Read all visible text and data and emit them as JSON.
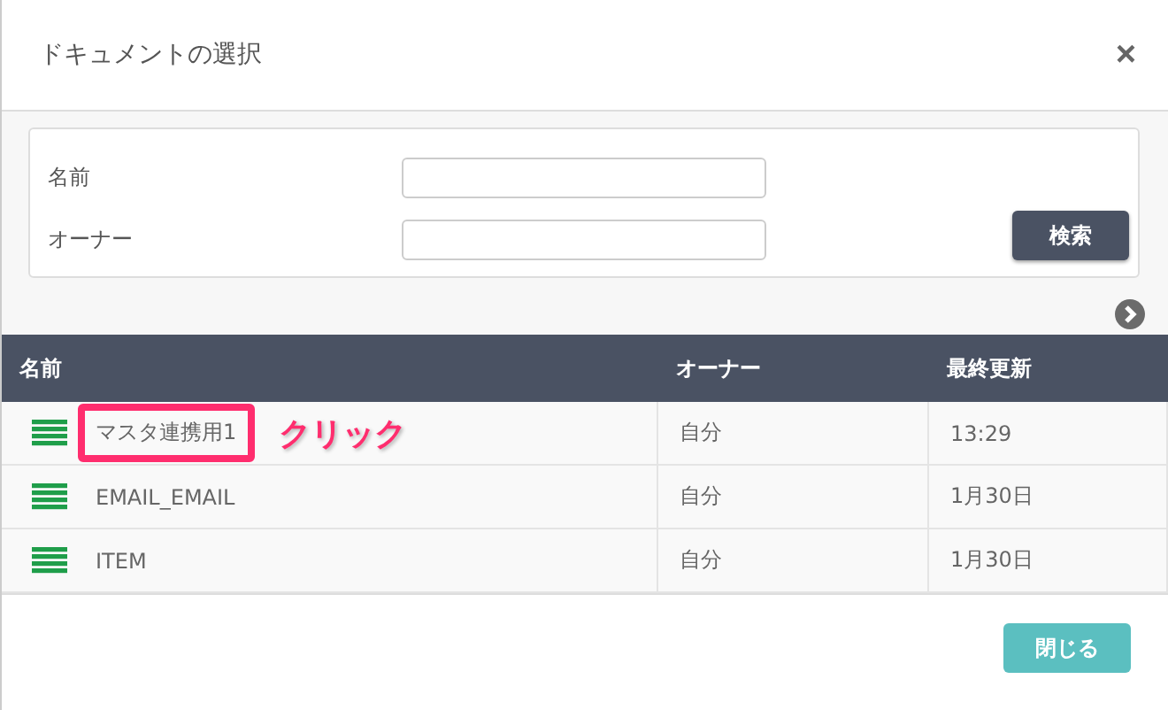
{
  "dialog": {
    "title": "ドキュメントの選択",
    "close": "×"
  },
  "search": {
    "fields": [
      {
        "label": "名前"
      },
      {
        "label": "オーナー"
      }
    ],
    "button": "検索"
  },
  "table": {
    "columns": [
      "名前",
      "オーナー",
      "最終更新"
    ],
    "rows": [
      {
        "name": "マスタ連携用1",
        "owner": "自分",
        "updated": "13:29",
        "highlighted": true,
        "callout": "クリック"
      },
      {
        "name": "EMAIL_EMAIL",
        "owner": "自分",
        "updated": "1月30日",
        "highlighted": false
      },
      {
        "name": "ITEM",
        "owner": "自分",
        "updated": "1月30日",
        "highlighted": false
      }
    ]
  },
  "footer": {
    "button": "閉じる"
  }
}
